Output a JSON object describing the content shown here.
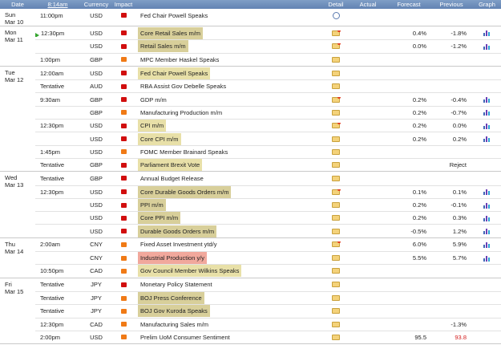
{
  "header": {
    "date": "Date",
    "time": "8:14am",
    "currency": "Currency",
    "impact": "Impact",
    "event": "",
    "detail": "Detail",
    "actual": "Actual",
    "forecast": "Forecast",
    "previous": "Previous",
    "graph": "Graph"
  },
  "days": [
    {
      "weekday": "Sun",
      "date": "Mar 10",
      "rows": [
        {
          "time": "11:00pm",
          "currency": "USD",
          "impact": "high",
          "event": "Fed Chair Powell Speaks",
          "highlight": "",
          "detail": "clock",
          "actual": "",
          "forecast": "",
          "previous": "",
          "graph": false
        }
      ]
    },
    {
      "weekday": "Mon",
      "date": "Mar 11",
      "rows": [
        {
          "time": "12:30pm",
          "current": true,
          "currency": "USD",
          "impact": "high",
          "event": "Core Retail Sales m/m",
          "highlight": "tan",
          "detail": "folder-star",
          "actual": "",
          "forecast": "0.4%",
          "previous": "-1.8%",
          "graph": true
        },
        {
          "time": "",
          "currency": "USD",
          "impact": "high",
          "event": "Retail Sales m/m",
          "highlight": "tan",
          "detail": "folder-star",
          "actual": "",
          "forecast": "0.0%",
          "previous": "-1.2%",
          "graph": true
        },
        {
          "time": "1:00pm",
          "currency": "GBP",
          "impact": "med",
          "event": "MPC Member Haskel Speaks",
          "highlight": "",
          "detail": "folder",
          "actual": "",
          "forecast": "",
          "previous": "",
          "graph": false
        }
      ]
    },
    {
      "weekday": "Tue",
      "date": "Mar 12",
      "rows": [
        {
          "time": "12:00am",
          "currency": "USD",
          "impact": "high",
          "event": "Fed Chair Powell Speaks",
          "highlight": "yellow",
          "detail": "folder",
          "actual": "",
          "forecast": "",
          "previous": "",
          "graph": false
        },
        {
          "time": "Tentative",
          "currency": "AUD",
          "impact": "high",
          "event": "RBA Assist Gov Debelle Speaks",
          "highlight": "",
          "detail": "folder",
          "actual": "",
          "forecast": "",
          "previous": "",
          "graph": false
        },
        {
          "time": "9:30am",
          "currency": "GBP",
          "impact": "high",
          "event": "GDP m/m",
          "highlight": "",
          "detail": "folder-star",
          "actual": "",
          "forecast": "0.2%",
          "previous": "-0.4%",
          "graph": true
        },
        {
          "time": "",
          "currency": "GBP",
          "impact": "med",
          "event": "Manufacturing Production m/m",
          "highlight": "",
          "detail": "folder",
          "actual": "",
          "forecast": "0.2%",
          "previous": "-0.7%",
          "graph": true
        },
        {
          "time": "12:30pm",
          "currency": "USD",
          "impact": "high",
          "event": "CPI m/m",
          "highlight": "yellow",
          "detail": "folder-star",
          "actual": "",
          "forecast": "0.2%",
          "previous": "0.0%",
          "graph": true
        },
        {
          "time": "",
          "currency": "USD",
          "impact": "high",
          "event": "Core CPI m/m",
          "highlight": "yellow",
          "detail": "folder",
          "actual": "",
          "forecast": "0.2%",
          "previous": "0.2%",
          "graph": true
        },
        {
          "time": "1:45pm",
          "currency": "USD",
          "impact": "med",
          "event": "FOMC Member Brainard Speaks",
          "highlight": "",
          "detail": "folder",
          "actual": "",
          "forecast": "",
          "previous": "",
          "graph": false
        },
        {
          "time": "Tentative",
          "currency": "GBP",
          "impact": "high",
          "event": "Parliament Brexit Vote",
          "highlight": "yellow",
          "detail": "folder",
          "actual": "",
          "forecast": "",
          "previous": "Reject",
          "graph": false
        }
      ]
    },
    {
      "weekday": "Wed",
      "date": "Mar 13",
      "rows": [
        {
          "time": "Tentative",
          "currency": "GBP",
          "impact": "high",
          "event": "Annual Budget Release",
          "highlight": "",
          "detail": "folder",
          "actual": "",
          "forecast": "",
          "previous": "",
          "graph": false
        },
        {
          "time": "12:30pm",
          "currency": "USD",
          "impact": "high",
          "event": "Core Durable Goods Orders m/m",
          "highlight": "tan",
          "detail": "folder-star",
          "actual": "",
          "forecast": "0.1%",
          "previous": "0.1%",
          "graph": true
        },
        {
          "time": "",
          "currency": "USD",
          "impact": "high",
          "event": "PPI m/m",
          "highlight": "tan",
          "detail": "folder",
          "actual": "",
          "forecast": "0.2%",
          "previous": "-0.1%",
          "graph": true
        },
        {
          "time": "",
          "currency": "USD",
          "impact": "high",
          "event": "Core PPI m/m",
          "highlight": "tan",
          "detail": "folder",
          "actual": "",
          "forecast": "0.2%",
          "previous": "0.3%",
          "graph": true
        },
        {
          "time": "",
          "currency": "USD",
          "impact": "high",
          "event": "Durable Goods Orders m/m",
          "highlight": "tan",
          "detail": "folder",
          "actual": "",
          "forecast": "-0.5%",
          "previous": "1.2%",
          "graph": true
        }
      ]
    },
    {
      "weekday": "Thu",
      "date": "Mar 14",
      "rows": [
        {
          "time": "2:00am",
          "currency": "CNY",
          "impact": "med",
          "event": "Fixed Asset Investment ytd/y",
          "highlight": "",
          "detail": "folder-star",
          "actual": "",
          "forecast": "6.0%",
          "previous": "5.9%",
          "graph": true
        },
        {
          "time": "",
          "currency": "CNY",
          "impact": "med",
          "event": "Industrial Production y/y",
          "highlight": "red",
          "detail": "folder",
          "actual": "",
          "forecast": "5.5%",
          "previous": "5.7%",
          "graph": true
        },
        {
          "time": "10:50pm",
          "currency": "CAD",
          "impact": "med",
          "event": "Gov Council Member Wilkins Speaks",
          "highlight": "yellow",
          "detail": "folder",
          "actual": "",
          "forecast": "",
          "previous": "",
          "graph": false
        }
      ]
    },
    {
      "weekday": "Fri",
      "date": "Mar 15",
      "rows": [
        {
          "time": "Tentative",
          "currency": "JPY",
          "impact": "high",
          "event": "Monetary Policy Statement",
          "highlight": "",
          "detail": "folder",
          "actual": "",
          "forecast": "",
          "previous": "",
          "graph": false
        },
        {
          "time": "Tentative",
          "currency": "JPY",
          "impact": "med",
          "event": "BOJ Press Conference",
          "highlight": "tan",
          "detail": "folder",
          "actual": "",
          "forecast": "",
          "previous": "",
          "graph": false
        },
        {
          "time": "Tentative",
          "currency": "JPY",
          "impact": "med",
          "event": "BOJ Gov Kuroda Speaks",
          "highlight": "tan",
          "detail": "folder",
          "actual": "",
          "forecast": "",
          "previous": "",
          "graph": false
        },
        {
          "time": "12:30pm",
          "currency": "CAD",
          "impact": "med",
          "event": "Manufacturing Sales m/m",
          "highlight": "",
          "detail": "folder",
          "actual": "",
          "forecast": "",
          "previous": "-1.3%",
          "graph": false
        },
        {
          "time": "2:00pm",
          "currency": "USD",
          "impact": "med",
          "event": "Prelim UoM Consumer Sentiment",
          "highlight": "",
          "detail": "folder",
          "actual": "",
          "forecast": "95.5",
          "previous": "93.8",
          "previous_color": "red",
          "graph": false
        }
      ]
    }
  ]
}
